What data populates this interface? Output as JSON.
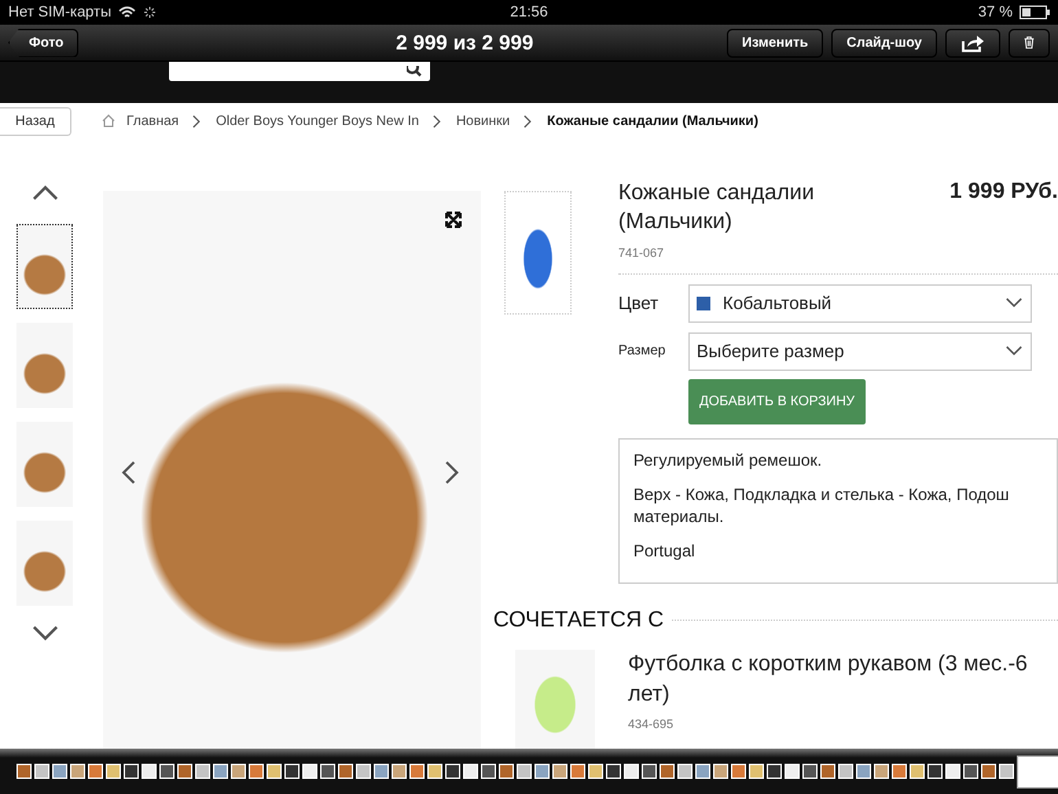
{
  "status_bar": {
    "carrier": "Нет SIM-карты",
    "time": "21:56",
    "battery": "37 %"
  },
  "toolbar": {
    "back": "Фото",
    "title": "2 999 из 2 999",
    "buttons": [
      "Изменить",
      "Слайд-шоу"
    ]
  },
  "breadcrumb": {
    "back": "Назад",
    "items": [
      {
        "label": "Главная",
        "current": false
      },
      {
        "label": "Older Boys Younger Boys New In",
        "current": false
      },
      {
        "label": "Новинки",
        "current": false
      },
      {
        "label": "Кожаные сандалии (Мальчики)",
        "current": true
      }
    ]
  },
  "gallery": {
    "thumbnails": [
      {
        "selected": true
      },
      {
        "selected": false
      },
      {
        "selected": false
      },
      {
        "selected": false
      }
    ]
  },
  "product": {
    "title": "Кожаные сандалии (Мальчики)",
    "price": "1 999 РУб.",
    "code": "741-067",
    "color_label": "Цвет",
    "color_value": "Кобальтовый",
    "color": "#2d5fa8",
    "size_label": "Размер",
    "size_placeholder": "Выберите размер",
    "add_button": "ДОБАВИТЬ В КОРЗИНУ",
    "description": [
      [
        "Регулируемый ремешок."
      ],
      [
        "Верх - Кожа, Подкладка и стелька - Кожа, Подош",
        "материалы."
      ],
      [
        "Portugal"
      ]
    ]
  },
  "related": {
    "heading": "СОЧЕТАЕТСЯ С",
    "items": [
      {
        "title_lines": [
          "Футболка с коротким рукавом (3 мес.-6",
          "лет)"
        ],
        "code": "434-695"
      }
    ]
  }
}
